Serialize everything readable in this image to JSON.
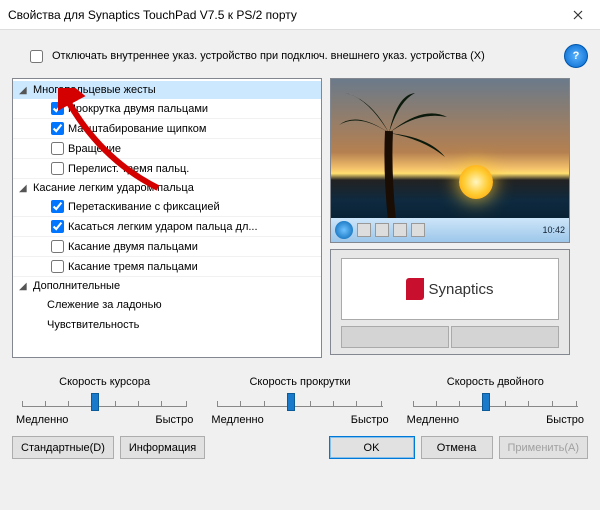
{
  "window": {
    "title": "Свойства для Synaptics TouchPad V7.5 к PS/2 порту"
  },
  "top_checkbox": {
    "label": "Отключать внутреннее указ. устройство при подключ. внешнего указ. устройства (X)",
    "checked": false
  },
  "tree": {
    "groups": [
      {
        "label": "Многопальцевые жесты",
        "expanded": true,
        "highlighted": true,
        "items": [
          {
            "label": "Прокрутка двумя пальцами",
            "checked": true
          },
          {
            "label": "Масштабирование щипком",
            "checked": true
          },
          {
            "label": "Вращение",
            "checked": false
          },
          {
            "label": "Перелист. тремя пальц.",
            "checked": false
          }
        ]
      },
      {
        "label": "Касание легким ударом пальца",
        "expanded": true,
        "highlighted": false,
        "items": [
          {
            "label": "Перетаскивание с фиксацией",
            "checked": true
          },
          {
            "label": "Касаться легким ударом пальца дл...",
            "checked": true
          },
          {
            "label": "Касание двумя пальцами",
            "checked": false
          },
          {
            "label": "Касание тремя пальцами",
            "checked": false
          }
        ]
      },
      {
        "label": "Дополнительные",
        "expanded": true,
        "highlighted": false,
        "subitems": [
          "Слежение за ладонью",
          "Чувствительность"
        ]
      }
    ]
  },
  "preview": {
    "logo_text": "Synaptics",
    "taskbar_time": "10:42"
  },
  "sliders": [
    {
      "title": "Скорость курсора",
      "min_label": "Медленно",
      "max_label": "Быстро",
      "value_pct": 42
    },
    {
      "title": "Скорость прокрутки",
      "min_label": "Медленно",
      "max_label": "Быстро",
      "value_pct": 42
    },
    {
      "title": "Скорость двойного",
      "min_label": "Медленно",
      "max_label": "Быстро",
      "value_pct": 42
    }
  ],
  "buttons": {
    "defaults": "Стандартные(D)",
    "info": "Информация",
    "ok": "OK",
    "cancel": "Отмена",
    "apply": "Применить(A)"
  }
}
